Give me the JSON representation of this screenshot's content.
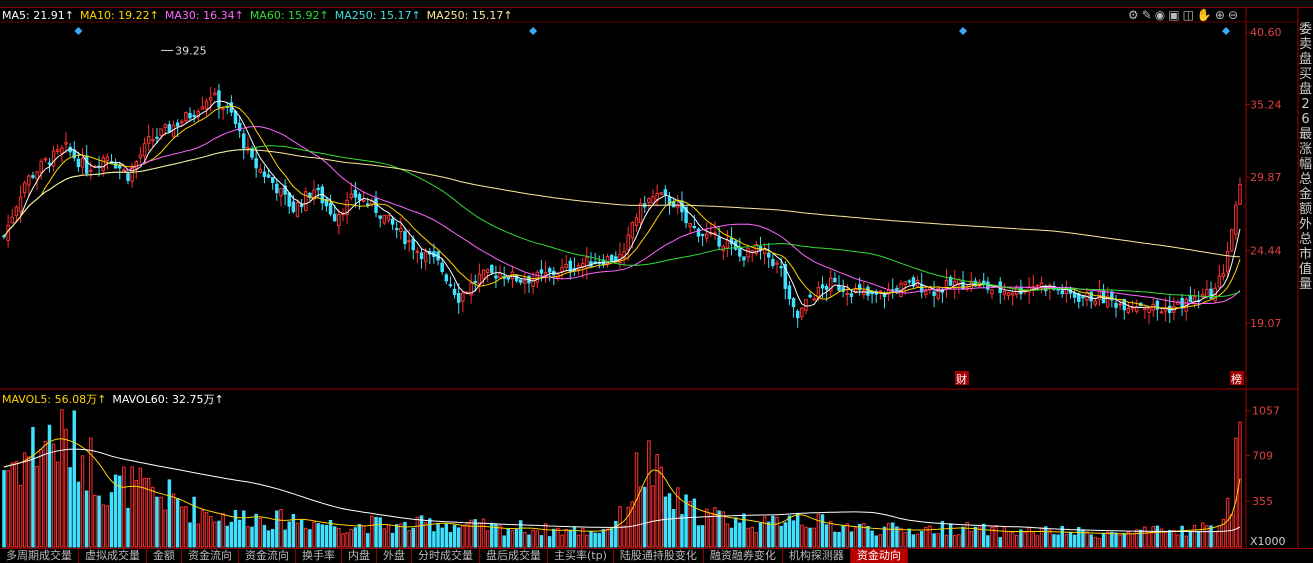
{
  "legend": [
    {
      "label": "MA5: 21.91↑",
      "color": "#ffffff"
    },
    {
      "label": "MA10: 19.22↑",
      "color": "#ffd400"
    },
    {
      "label": "MA30: 16.34↑",
      "color": "#ff66ff"
    },
    {
      "label": "MA60: 15.92↑",
      "color": "#33dd33"
    },
    {
      "label": "MA250: 15.17↑",
      "color": "#44dddd"
    },
    {
      "label": "MA250: 15.17↑",
      "color": "#ffe8a0"
    }
  ],
  "volume_legend": [
    {
      "label": "MAVOL5: 56.08万↑",
      "color": "#ffd400"
    },
    {
      "label": "MAVOL60: 32.75万↑",
      "color": "#ffffff"
    }
  ],
  "toolbar_icons": [
    "gear-icon",
    "pen-icon",
    "eye-icon",
    "lock-icon",
    "bag-icon",
    "hand-icon",
    "add-icon",
    "remove-icon"
  ],
  "right_panel": "委卖盘买盘26最涨幅总金额外总市值量",
  "bottom_tabs": [
    {
      "label": "多周期成交量",
      "hot": false
    },
    {
      "label": "虚拟成交量",
      "hot": false
    },
    {
      "label": "金额",
      "hot": false
    },
    {
      "label": "资金流向",
      "hot": false
    },
    {
      "label": "资金流向",
      "hot": false
    },
    {
      "label": "换手率",
      "hot": false
    },
    {
      "label": "内盘",
      "hot": false
    },
    {
      "label": "外盘",
      "hot": false
    },
    {
      "label": "分时成交量",
      "hot": false
    },
    {
      "label": "盘后成交量",
      "hot": false
    },
    {
      "label": "主买率(tp)",
      "hot": false
    },
    {
      "label": "陆股通持股变化",
      "hot": false
    },
    {
      "label": "融资融券变化",
      "hot": false
    },
    {
      "label": "机构探测器",
      "hot": false
    },
    {
      "label": "资金动向",
      "hot": true
    }
  ],
  "chart_data": {
    "type": "candlestick",
    "price_axis": {
      "ticks": [
        40.6,
        35.24,
        29.87,
        24.44,
        19.07
      ],
      "range": [
        14.5,
        41.5
      ]
    },
    "volume_axis": {
      "ticks": [
        1057,
        709,
        355
      ],
      "unit": "X1000",
      "range": [
        0,
        1100
      ]
    },
    "high_annotation": "39.25",
    "event_markers": [
      "财",
      "榜"
    ],
    "price_path": [
      [
        0,
        25.5
      ],
      [
        5,
        29.5
      ],
      [
        10,
        31.0
      ],
      [
        15,
        32.0
      ],
      [
        20,
        30.5
      ],
      [
        25,
        31.5
      ],
      [
        30,
        30.0
      ],
      [
        35,
        32.5
      ],
      [
        40,
        33.5
      ],
      [
        45,
        34.5
      ],
      [
        50,
        36.0
      ],
      [
        55,
        34.5
      ],
      [
        60,
        31.0
      ],
      [
        65,
        29.5
      ],
      [
        70,
        27.5
      ],
      [
        75,
        29.0
      ],
      [
        80,
        27.0
      ],
      [
        85,
        28.5
      ],
      [
        90,
        27.5
      ],
      [
        95,
        26.0
      ],
      [
        100,
        24.5
      ],
      [
        105,
        23.5
      ],
      [
        108,
        22.0
      ],
      [
        110,
        21.0
      ],
      [
        115,
        22.5
      ],
      [
        120,
        22.8
      ],
      [
        125,
        22.3
      ],
      [
        130,
        22.5
      ],
      [
        135,
        23.0
      ],
      [
        140,
        23.5
      ],
      [
        145,
        23.8
      ],
      [
        150,
        24.0
      ],
      [
        152,
        26.5
      ],
      [
        155,
        28.0
      ],
      [
        158,
        28.5
      ],
      [
        162,
        28.0
      ],
      [
        165,
        26.5
      ],
      [
        170,
        25.5
      ],
      [
        175,
        25.0
      ],
      [
        178,
        24.0
      ],
      [
        182,
        24.5
      ],
      [
        185,
        24.0
      ],
      [
        188,
        23.0
      ],
      [
        190,
        20.5
      ],
      [
        192,
        19.5
      ],
      [
        195,
        21.0
      ],
      [
        200,
        22.0
      ],
      [
        205,
        21.5
      ],
      [
        210,
        21.0
      ],
      [
        215,
        21.5
      ],
      [
        220,
        22.0
      ],
      [
        225,
        21.5
      ],
      [
        230,
        22.0
      ],
      [
        235,
        22.0
      ],
      [
        240,
        21.5
      ],
      [
        245,
        21.5
      ],
      [
        250,
        22.0
      ],
      [
        255,
        21.5
      ],
      [
        260,
        21.0
      ],
      [
        265,
        21.0
      ],
      [
        270,
        20.5
      ],
      [
        275,
        20.5
      ],
      [
        280,
        20.0
      ],
      [
        285,
        20.5
      ],
      [
        290,
        21.0
      ],
      [
        293,
        21.5
      ],
      [
        295,
        23.0
      ],
      [
        297,
        26.0
      ],
      [
        299,
        29.0
      ]
    ],
    "volume_path": [
      [
        0,
        620
      ],
      [
        5,
        700
      ],
      [
        10,
        850
      ],
      [
        15,
        820
      ],
      [
        20,
        700
      ],
      [
        25,
        450
      ],
      [
        30,
        480
      ],
      [
        35,
        420
      ],
      [
        40,
        380
      ],
      [
        45,
        300
      ],
      [
        50,
        260
      ],
      [
        55,
        220
      ],
      [
        60,
        240
      ],
      [
        65,
        200
      ],
      [
        70,
        220
      ],
      [
        75,
        190
      ],
      [
        80,
        170
      ],
      [
        85,
        160
      ],
      [
        90,
        180
      ],
      [
        95,
        150
      ],
      [
        100,
        170
      ],
      [
        105,
        190
      ],
      [
        110,
        160
      ],
      [
        115,
        160
      ],
      [
        120,
        140
      ],
      [
        125,
        150
      ],
      [
        130,
        130
      ],
      [
        135,
        130
      ],
      [
        140,
        120
      ],
      [
        145,
        130
      ],
      [
        150,
        250
      ],
      [
        153,
        550
      ],
      [
        156,
        650
      ],
      [
        160,
        400
      ],
      [
        165,
        300
      ],
      [
        170,
        250
      ],
      [
        175,
        220
      ],
      [
        180,
        200
      ],
      [
        185,
        160
      ],
      [
        190,
        270
      ],
      [
        195,
        200
      ],
      [
        200,
        170
      ],
      [
        210,
        140
      ],
      [
        220,
        130
      ],
      [
        230,
        150
      ],
      [
        240,
        120
      ],
      [
        250,
        120
      ],
      [
        260,
        110
      ],
      [
        270,
        100
      ],
      [
        280,
        120
      ],
      [
        290,
        140
      ],
      [
        295,
        200
      ],
      [
        297,
        380
      ],
      [
        299,
        1057
      ]
    ]
  }
}
